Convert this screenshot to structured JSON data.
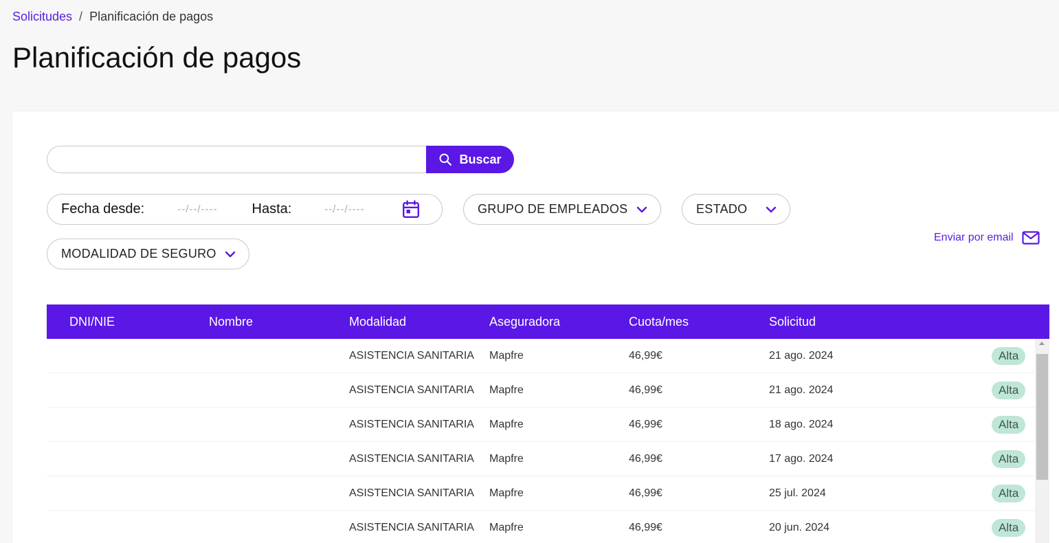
{
  "breadcrumb": {
    "parent": "Solicitudes",
    "separator": "/",
    "current": "Planificación de pagos"
  },
  "page": {
    "title": "Planificación de pagos"
  },
  "search": {
    "value": "",
    "placeholder": "",
    "button_label": "Buscar"
  },
  "filters": {
    "date_from_label": "Fecha desde:",
    "date_from_placeholder": "--/--/----",
    "date_to_label": "Hasta:",
    "date_to_placeholder": "--/--/----",
    "grupo": "GRUPO DE EMPLEADOS",
    "estado": "ESTADO",
    "modalidad": "MODALIDAD DE SEGURO"
  },
  "actions": {
    "email_label": "Enviar por email"
  },
  "accent_color": "#5a17e6",
  "table": {
    "columns": [
      "DNI/NIE",
      "Nombre",
      "Modalidad",
      "Aseguradora",
      "Cuota/mes",
      "Solicitud"
    ],
    "rows": [
      {
        "dni": "",
        "nombre": "",
        "modalidad": "ASISTENCIA SANITARIA",
        "aseguradora": "Mapfre",
        "cuota": "46,99€",
        "solicitud": "21 ago. 2024",
        "estado": "Alta"
      },
      {
        "dni": "",
        "nombre": "",
        "modalidad": "ASISTENCIA SANITARIA",
        "aseguradora": "Mapfre",
        "cuota": "46,99€",
        "solicitud": "21 ago. 2024",
        "estado": "Alta"
      },
      {
        "dni": "",
        "nombre": "",
        "modalidad": "ASISTENCIA SANITARIA",
        "aseguradora": "Mapfre",
        "cuota": "46,99€",
        "solicitud": "18 ago. 2024",
        "estado": "Alta"
      },
      {
        "dni": "",
        "nombre": "",
        "modalidad": "ASISTENCIA SANITARIA",
        "aseguradora": "Mapfre",
        "cuota": "46,99€",
        "solicitud": "17 ago. 2024",
        "estado": "Alta"
      },
      {
        "dni": "",
        "nombre": "",
        "modalidad": "ASISTENCIA SANITARIA",
        "aseguradora": "Mapfre",
        "cuota": "46,99€",
        "solicitud": "25 jul. 2024",
        "estado": "Alta"
      },
      {
        "dni": "",
        "nombre": "",
        "modalidad": "ASISTENCIA SANITARIA",
        "aseguradora": "Mapfre",
        "cuota": "46,99€",
        "solicitud": "20 jun. 2024",
        "estado": "Alta"
      }
    ]
  }
}
